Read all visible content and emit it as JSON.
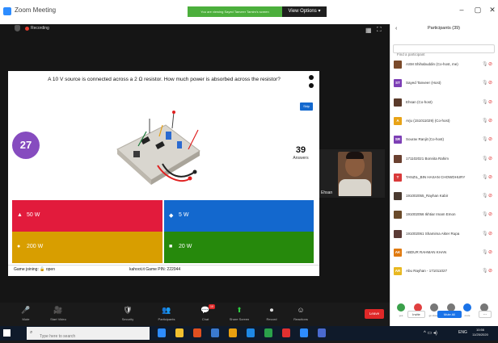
{
  "window": {
    "title": "Zoom Meeting",
    "share_banner": "You are viewing Sayed Tanveer Tamim's screen",
    "view_options": "View Options ▾",
    "controls": [
      "–",
      "▢",
      "✕"
    ]
  },
  "meeting": {
    "recording_label": "Recording",
    "question": "A 10 V source is connected across a 2 Ω resistor. How much power is absorbed across the resistor?",
    "skip_label": "Skip",
    "timer": "27",
    "answers_count": "39",
    "answers_label": "Answers",
    "answers": [
      {
        "shape": "▲",
        "label": "50 W",
        "color": "#e21b3c"
      },
      {
        "shape": "◆",
        "label": "5 W",
        "color": "#1368ce"
      },
      {
        "shape": "●",
        "label": "200 W",
        "color": "#d89e00"
      },
      {
        "shape": "■",
        "label": "20 W",
        "color": "#26890c"
      }
    ],
    "game_joining": "Game joining: 🔓 open",
    "game_pin": "kahoot.it Game PIN: 222044",
    "video_name": "Ehsan"
  },
  "toolbar": {
    "items": [
      {
        "icon": "🎤",
        "label": "Mute"
      },
      {
        "icon": "🎥",
        "label": "Start Video"
      },
      {
        "icon": "🛡",
        "label": "Security"
      },
      {
        "icon": "👥",
        "label": "Participants"
      },
      {
        "icon": "💬",
        "label": "Chat"
      },
      {
        "icon": "⬆",
        "label": "Share Screen"
      },
      {
        "icon": "⏺",
        "label": "Record"
      },
      {
        "icon": "☺",
        "label": "Reactions"
      }
    ],
    "participants_count": "39",
    "chat_badge": "10",
    "end_label": "Leave"
  },
  "panel": {
    "back": "‹",
    "title": "Participants (39)",
    "search_placeholder": "Find a participant",
    "participants": [
      {
        "name": "ASM Shihabuddin (Co-host, me)",
        "avatar_color": "#7a4a2a",
        "initial": ""
      },
      {
        "name": "Sayed Tanveer (Host)",
        "avatar_color": "#7d3fb5",
        "initial": "ST"
      },
      {
        "name": "Ehsan (Co-host)",
        "avatar_color": "#5a3a2a",
        "initial": ""
      },
      {
        "name": "Arju (151011029) (Co-host)",
        "avatar_color": "#e8a317",
        "initial": "A"
      },
      {
        "name": "Sourav Ranjit (Co-host)",
        "avatar_color": "#7d3fb5",
        "initial": "SR"
      },
      {
        "name": "171102021 Bonnita Rahim",
        "avatar_color": "#6a4030",
        "initial": ""
      },
      {
        "name": "TANZIL_BIN HASAN CHOWDHURY",
        "avatar_color": "#d93a3a",
        "initial": "T"
      },
      {
        "name": "191002055_Rayhan Kabir",
        "avatar_color": "#4a3a30",
        "initial": ""
      },
      {
        "name": "191002056 Ikhtiar Imam Emon",
        "avatar_color": "#6a4a2a",
        "initial": ""
      },
      {
        "name": "191002061 Shamima Akter Rupa",
        "avatar_color": "#5a3a35",
        "initial": ""
      },
      {
        "name": "ABDUR RAHMAN KHAN",
        "avatar_color": "#e07a10",
        "initial": "AK"
      },
      {
        "name": "Abu Rayhan - 171011027",
        "avatar_color": "#e8b820",
        "initial": "AR"
      }
    ],
    "reactions": [
      {
        "color": "#3aa04a",
        "label": "yes"
      },
      {
        "color": "#e04040",
        "label": "no"
      },
      {
        "color": "#777777",
        "label": "go slower"
      },
      {
        "color": "#777777",
        "label": "go faster"
      },
      {
        "color": "#1a73e8",
        "label": "more"
      },
      {
        "color": "#777777",
        "label": "clear all"
      }
    ],
    "invite_label": "Invite",
    "mute_all_label": "Mute All",
    "more_label": "..."
  },
  "taskbar": {
    "search_placeholder": "Type here to search",
    "tray": "^ ▭ ◂) ENG",
    "lang": "ENG",
    "time": "10:56",
    "date": "11/25/2020",
    "apps": [
      "#2d8cff",
      "#f0c030",
      "#e05020",
      "#3a7ad0",
      "#e8a010",
      "#1e88e5",
      "#2aa14a",
      "#e03030",
      "#2d8cff",
      "#4a6ad0"
    ]
  }
}
